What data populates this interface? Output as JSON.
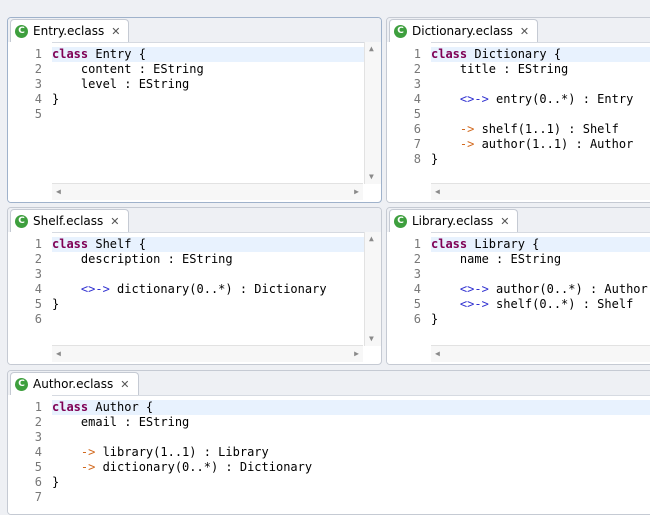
{
  "editors": [
    {
      "id": "entry",
      "tab": "Entry.eclass",
      "lines": [
        [
          {
            "k": "kw",
            "t": "class"
          },
          {
            "k": "t",
            "t": " Entry {"
          }
        ],
        [
          {
            "k": "t",
            "t": "    content : EString"
          }
        ],
        [
          {
            "k": "t",
            "t": "    level : EString"
          }
        ],
        [
          {
            "k": "t",
            "t": "}"
          }
        ],
        []
      ]
    },
    {
      "id": "dictionary",
      "tab": "Dictionary.eclass",
      "lines": [
        [
          {
            "k": "kw",
            "t": "class"
          },
          {
            "k": "t",
            "t": " Dictionary {"
          }
        ],
        [
          {
            "k": "t",
            "t": "    title : EString"
          }
        ],
        [],
        [
          {
            "k": "t",
            "t": "    "
          },
          {
            "k": "op",
            "t": "<>->"
          },
          {
            "k": "t",
            "t": " entry(0..*) : Entry"
          }
        ],
        [],
        [
          {
            "k": "t",
            "t": "    "
          },
          {
            "k": "arr",
            "t": "->"
          },
          {
            "k": "t",
            "t": " shelf(1..1) : Shelf"
          }
        ],
        [
          {
            "k": "t",
            "t": "    "
          },
          {
            "k": "arr",
            "t": "->"
          },
          {
            "k": "t",
            "t": " author(1..1) : Author"
          }
        ],
        [
          {
            "k": "t",
            "t": "}"
          }
        ]
      ]
    },
    {
      "id": "shelf",
      "tab": "Shelf.eclass",
      "lines": [
        [
          {
            "k": "kw",
            "t": "class"
          },
          {
            "k": "t",
            "t": " Shelf {"
          }
        ],
        [
          {
            "k": "t",
            "t": "    description : EString"
          }
        ],
        [],
        [
          {
            "k": "t",
            "t": "    "
          },
          {
            "k": "op",
            "t": "<>->"
          },
          {
            "k": "t",
            "t": " dictionary(0..*) : Dictionary"
          }
        ],
        [
          {
            "k": "t",
            "t": "}"
          }
        ],
        []
      ]
    },
    {
      "id": "library",
      "tab": "Library.eclass",
      "lines": [
        [
          {
            "k": "kw",
            "t": "class"
          },
          {
            "k": "t",
            "t": " Library {"
          }
        ],
        [
          {
            "k": "t",
            "t": "    name : EString"
          }
        ],
        [],
        [
          {
            "k": "t",
            "t": "    "
          },
          {
            "k": "op",
            "t": "<>->"
          },
          {
            "k": "t",
            "t": " author(0..*) : Author"
          }
        ],
        [
          {
            "k": "t",
            "t": "    "
          },
          {
            "k": "op",
            "t": "<>->"
          },
          {
            "k": "t",
            "t": " shelf(0..*) : Shelf"
          }
        ],
        [
          {
            "k": "t",
            "t": "}"
          }
        ]
      ]
    },
    {
      "id": "author",
      "tab": "Author.eclass",
      "lines": [
        [
          {
            "k": "kw",
            "t": "class"
          },
          {
            "k": "t",
            "t": " Author {"
          }
        ],
        [
          {
            "k": "t",
            "t": "    email : EString"
          }
        ],
        [],
        [
          {
            "k": "t",
            "t": "    "
          },
          {
            "k": "arr",
            "t": "->"
          },
          {
            "k": "t",
            "t": " library(1..1) : Library"
          }
        ],
        [
          {
            "k": "t",
            "t": "    "
          },
          {
            "k": "arr",
            "t": "->"
          },
          {
            "k": "t",
            "t": " dictionary(0..*) : Dictionary"
          }
        ],
        [
          {
            "k": "t",
            "t": "}"
          }
        ],
        []
      ]
    }
  ],
  "icons": {
    "tab_icon": "eclass-file-icon",
    "tab_icon_glyph": "C",
    "close": "close-icon",
    "close_glyph": "✕"
  },
  "colors": {
    "keyword": "#7f0055",
    "containment_arrow": "#2f2fd0",
    "reference_arrow": "#d2691e",
    "current_line": "#e8f2fe",
    "class_icon": "#3e9f3e"
  }
}
